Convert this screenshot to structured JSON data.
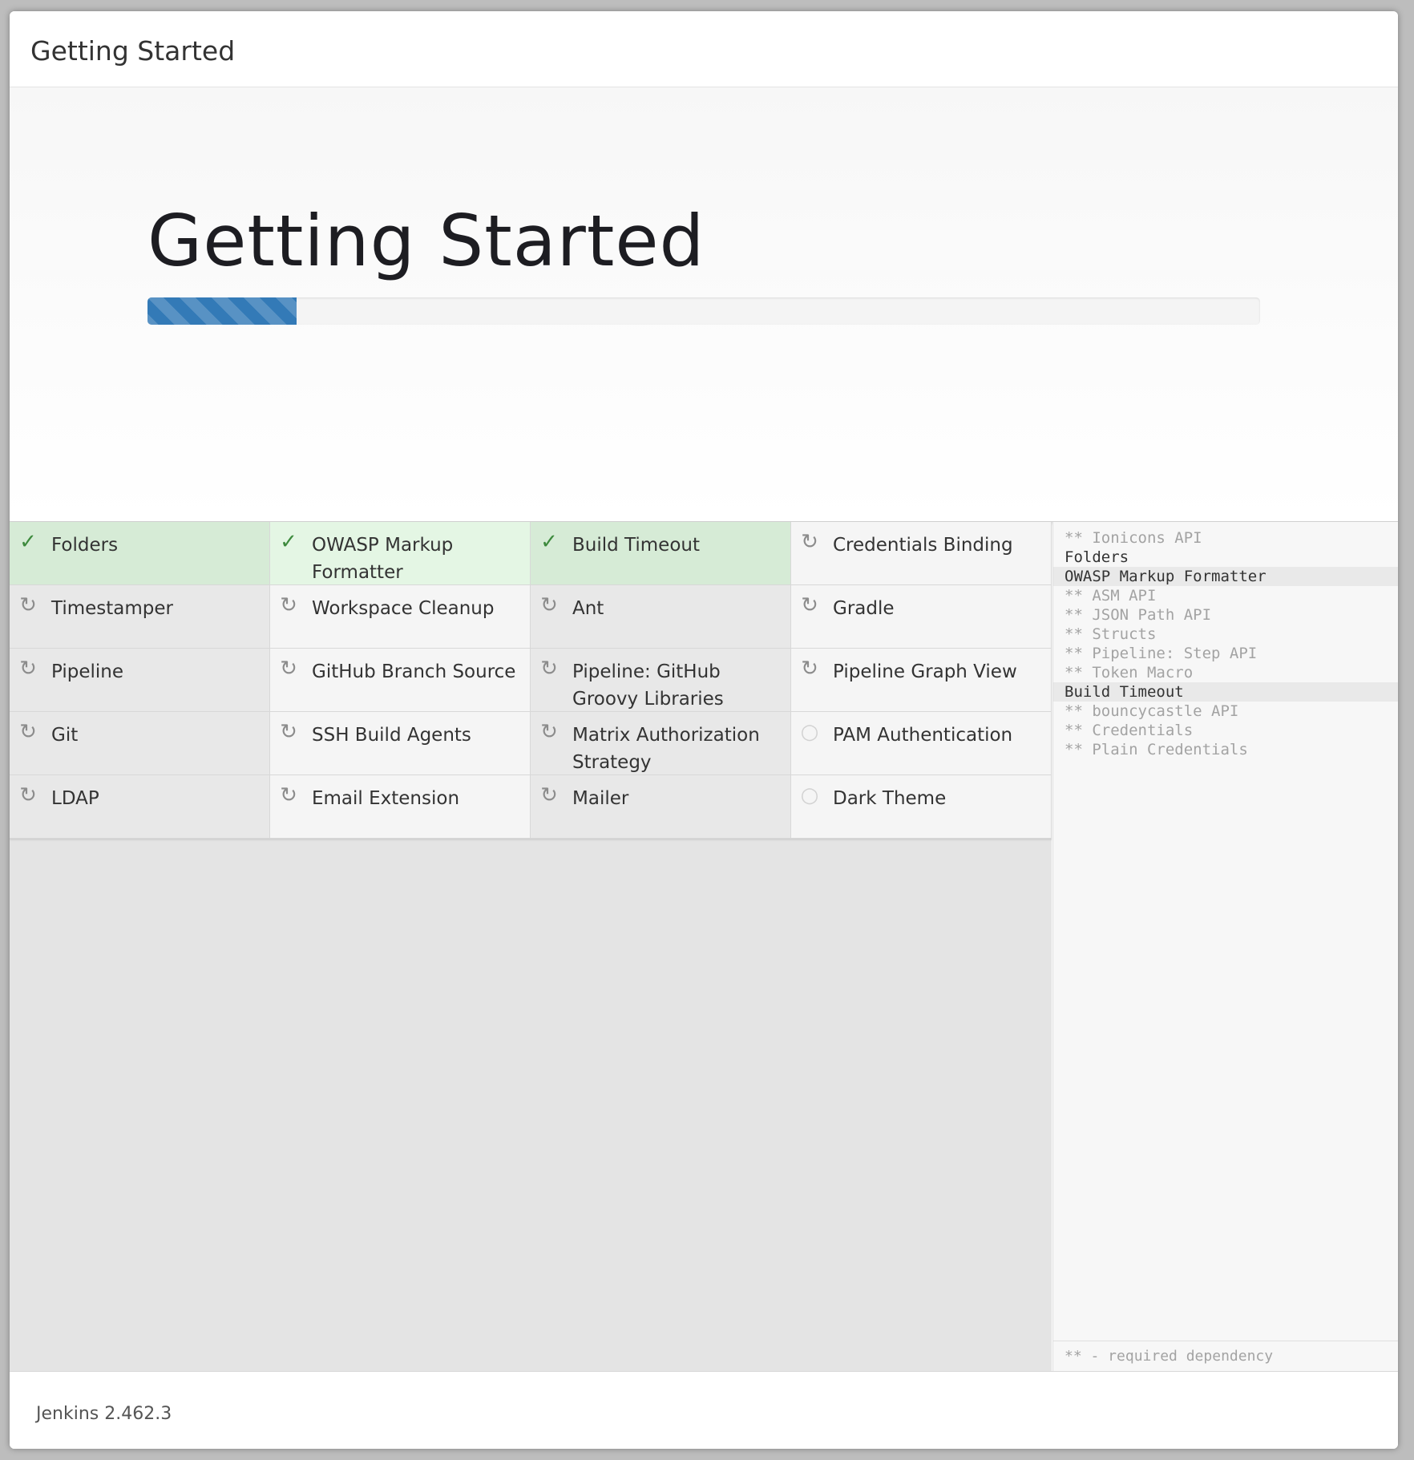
{
  "header": {
    "title": "Getting Started"
  },
  "jumbotron": {
    "title": "Getting Started",
    "progress_percent": 13.4
  },
  "plugins": [
    {
      "name": "Folders",
      "status": "success",
      "icon": "check-icon"
    },
    {
      "name": "OWASP Markup Formatter",
      "status": "success",
      "icon": "check-icon"
    },
    {
      "name": "Build Timeout",
      "status": "success",
      "icon": "check-icon"
    },
    {
      "name": "Credentials Binding",
      "status": "installing",
      "icon": "refresh-icon"
    },
    {
      "name": "Timestamper",
      "status": "installing",
      "icon": "refresh-icon"
    },
    {
      "name": "Workspace Cleanup",
      "status": "installing",
      "icon": "refresh-icon"
    },
    {
      "name": "Ant",
      "status": "installing",
      "icon": "refresh-icon"
    },
    {
      "name": "Gradle",
      "status": "installing",
      "icon": "refresh-icon"
    },
    {
      "name": "Pipeline",
      "status": "installing",
      "icon": "refresh-icon"
    },
    {
      "name": "GitHub Branch Source",
      "status": "installing",
      "icon": "refresh-icon"
    },
    {
      "name": "Pipeline: GitHub Groovy Libraries",
      "status": "installing",
      "icon": "refresh-icon"
    },
    {
      "name": "Pipeline Graph View",
      "status": "installing",
      "icon": "refresh-icon"
    },
    {
      "name": "Git",
      "status": "installing",
      "icon": "refresh-icon"
    },
    {
      "name": "SSH Build Agents",
      "status": "installing",
      "icon": "refresh-icon"
    },
    {
      "name": "Matrix Authorization Strategy",
      "status": "installing",
      "icon": "refresh-icon"
    },
    {
      "name": "PAM Authentication",
      "status": "pending",
      "icon": "circle-icon"
    },
    {
      "name": "LDAP",
      "status": "installing",
      "icon": "refresh-icon"
    },
    {
      "name": "Email Extension",
      "status": "installing",
      "icon": "refresh-icon"
    },
    {
      "name": "Mailer",
      "status": "installing",
      "icon": "refresh-icon"
    },
    {
      "name": "Dark Theme",
      "status": "pending",
      "icon": "circle-icon"
    }
  ],
  "log": {
    "lines": [
      {
        "text": "** Ionicons API",
        "type": "dependency",
        "active": false
      },
      {
        "text": "Folders",
        "type": "plugin",
        "active": false
      },
      {
        "text": "OWASP Markup Formatter",
        "type": "plugin",
        "active": true
      },
      {
        "text": "** ASM API",
        "type": "dependency",
        "active": false
      },
      {
        "text": "** JSON Path API",
        "type": "dependency",
        "active": false
      },
      {
        "text": "** Structs",
        "type": "dependency",
        "active": false
      },
      {
        "text": "** Pipeline: Step API",
        "type": "dependency",
        "active": false
      },
      {
        "text": "** Token Macro",
        "type": "dependency",
        "active": false
      },
      {
        "text": "Build Timeout",
        "type": "plugin",
        "active": true
      },
      {
        "text": "** bouncycastle API",
        "type": "dependency",
        "active": false
      },
      {
        "text": "** Credentials",
        "type": "dependency",
        "active": false
      },
      {
        "text": "** Plain Credentials",
        "type": "dependency",
        "active": false
      }
    ],
    "legend": "** - required dependency"
  },
  "footer": {
    "version": "Jenkins 2.462.3"
  },
  "icons": {
    "check-icon": "✓",
    "refresh-icon": "↻",
    "circle-icon": "○"
  },
  "colors": {
    "progress": "#337ab7",
    "success_bg": "#d6ebd6",
    "success_icon": "#3d8a3d"
  }
}
